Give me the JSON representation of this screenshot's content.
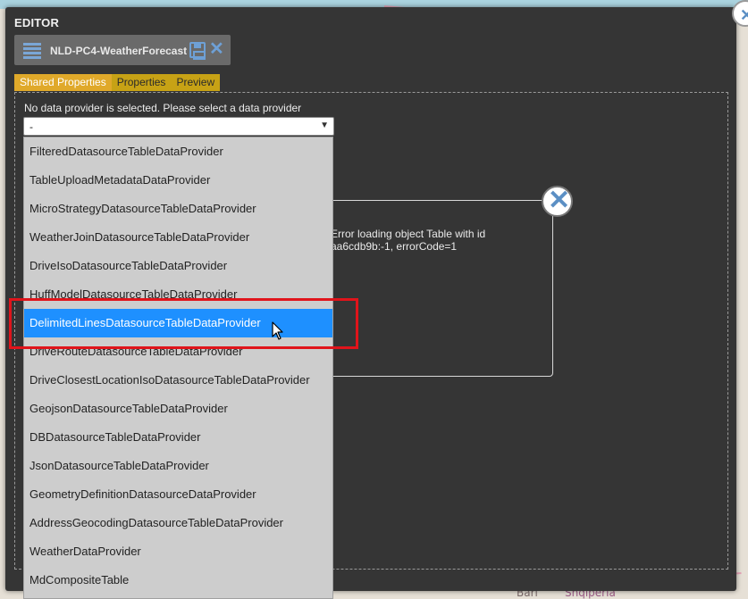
{
  "map": {
    "labels": [
      "Bari",
      "Shqiperia"
    ]
  },
  "editor": {
    "title": "EDITOR",
    "object_name": "NLD-PC4-WeatherForecast",
    "tabs": [
      {
        "label": "Shared Properties",
        "active": true
      },
      {
        "label": "Properties",
        "active": false
      },
      {
        "label": "Preview",
        "active": false
      }
    ],
    "notice": "No data provider is selected. Please select a data provider",
    "select": {
      "value": "-",
      "options": [
        "FilteredDatasourceTableDataProvider",
        "TableUploadMetadataDataProvider",
        "MicroStrategyDatasourceTableDataProvider",
        "WeatherJoinDatasourceTableDataProvider",
        "DriveIsoDatasourceTableDataProvider",
        "HuffModelDatasourceTableDataProvider",
        "DelimitedLinesDatasourceTableDataProvider",
        "DriveRouteDatasourceTableDataProvider",
        "DriveClosestLocationIsoDatasourceTableDataProvider",
        "GeojsonDatasourceTableDataProvider",
        "DBDatasourceTableDataProvider",
        "JsonDatasourceTableDataProvider",
        "GeometryDefinitionDatasourceDataProvider",
        "AddressGeocodingDatasourceTableDataProvider",
        "WeatherDataProvider",
        "MdCompositeTable"
      ],
      "highlighted_index": 6
    }
  },
  "error_dialog": {
    "line1": "Error loading object Table with id",
    "line2": "aa6cdb9b:-1, errorCode=1"
  },
  "icons": {
    "list": "list-icon",
    "save": "save-icon",
    "close": "close-icon"
  },
  "colors": {
    "highlight_box": "#e0141b",
    "selected_option": "#1e90ff",
    "tab_bar": "#c7a215",
    "dialog_bg": "#353535"
  }
}
